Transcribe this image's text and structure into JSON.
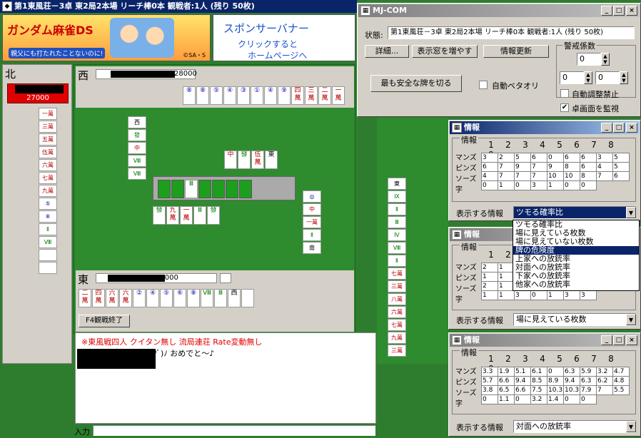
{
  "main": {
    "title": "第1東風荘－3卓 東2局2本場 リーチ棒0本 観戦者:1人 (残り 50枚)",
    "banner_left_line1": "ガンダム麻雀DS",
    "banner_left_line2": "親父にも打たれたことないのに!",
    "banner_copyright": "©SA・S",
    "banner_right_line1": "スポンサーバナー",
    "banner_right_line2": "クリックすると",
    "banner_right_line3": "ホームページへ"
  },
  "players": {
    "north": {
      "wind": "北",
      "score": "27000"
    },
    "west": {
      "wind": "西",
      "score": "28000"
    },
    "east": {
      "wind": "東",
      "score": "33000"
    }
  },
  "hands": {
    "west_hand": [
      {
        "t": "⑧",
        "c": "b"
      },
      {
        "t": "⑧",
        "c": "b"
      },
      {
        "t": "⑤",
        "c": "b"
      },
      {
        "t": "④",
        "c": "b"
      },
      {
        "t": "③",
        "c": "b"
      },
      {
        "t": "①",
        "c": "b"
      },
      {
        "t": "④",
        "c": "b"
      },
      {
        "t": "⑨",
        "c": "b"
      },
      {
        "t": "四萬",
        "c": "r"
      },
      {
        "t": "三萬",
        "c": "r"
      },
      {
        "t": "二萬",
        "c": "r"
      },
      {
        "t": "一萬",
        "c": "r"
      }
    ],
    "east_hand": [
      {
        "t": "二萬",
        "c": "r"
      },
      {
        "t": "四萬",
        "c": "r"
      },
      {
        "t": "六萬",
        "c": "r"
      },
      {
        "t": "六萬",
        "c": "r"
      },
      {
        "t": "②",
        "c": "b"
      },
      {
        "t": "④",
        "c": "b"
      },
      {
        "t": "⑤",
        "c": "b"
      },
      {
        "t": "⑥",
        "c": "b"
      },
      {
        "t": "⑧",
        "c": "b"
      },
      {
        "t": "Ⅷ",
        "c": "g"
      },
      {
        "t": "Ⅲ",
        "c": "g"
      },
      {
        "t": "西",
        "c": "k"
      },
      {
        "t": "",
        "c": "k"
      }
    ],
    "north_hand": [
      {
        "t": "一萬",
        "c": "r"
      },
      {
        "t": "三萬",
        "c": "r"
      },
      {
        "t": "五萬",
        "c": "r"
      },
      {
        "t": "伍萬",
        "c": "r"
      },
      {
        "t": "六萬",
        "c": "r"
      },
      {
        "t": "七萬",
        "c": "r"
      },
      {
        "t": "九萬",
        "c": "r"
      },
      {
        "t": "⑤",
        "c": "b"
      },
      {
        "t": "⑧",
        "c": "b"
      },
      {
        "t": "Ⅱ",
        "c": "g"
      },
      {
        "t": "Ⅷ",
        "c": "g"
      },
      {
        "t": "",
        "c": "k"
      },
      {
        "t": "",
        "c": "k"
      }
    ],
    "south_hand": [
      {
        "t": "東",
        "c": "k"
      },
      {
        "t": "Ⅸ",
        "c": "g"
      },
      {
        "t": "Ⅱ",
        "c": "g"
      },
      {
        "t": "Ⅲ",
        "c": "g"
      },
      {
        "t": "Ⅳ",
        "c": "g"
      },
      {
        "t": "Ⅷ",
        "c": "g"
      },
      {
        "t": "Ⅱ",
        "c": "g"
      },
      {
        "t": "七萬",
        "c": "r"
      },
      {
        "t": "三萬",
        "c": "r"
      },
      {
        "t": "八萬",
        "c": "r"
      },
      {
        "t": "六萬",
        "c": "r"
      },
      {
        "t": "七萬",
        "c": "r"
      },
      {
        "t": "九萬",
        "c": "r"
      },
      {
        "t": "三萬",
        "c": "r"
      }
    ],
    "west_discards": [
      {
        "t": "西",
        "c": "k"
      },
      {
        "t": "發",
        "c": "g"
      },
      {
        "t": "中",
        "c": "r"
      },
      {
        "t": "Ⅷ",
        "c": "g"
      },
      {
        "t": "Ⅷ",
        "c": "g"
      }
    ],
    "north_discards_top": [
      {
        "t": "中",
        "c": "r"
      },
      {
        "t": "發",
        "c": "g"
      },
      {
        "t": "伍萬",
        "c": "r"
      },
      {
        "t": "東",
        "c": "k"
      }
    ],
    "east_discards": [
      {
        "t": "發",
        "c": "g"
      },
      {
        "t": "九萬",
        "c": "r"
      },
      {
        "t": "一萬",
        "c": "r"
      },
      {
        "t": "Ⅲ",
        "c": "g"
      },
      {
        "t": "發",
        "c": "g"
      }
    ],
    "south_discards": [
      {
        "t": "◎",
        "c": "b"
      },
      {
        "t": "中",
        "c": "r"
      },
      {
        "t": "一萬",
        "c": "r"
      },
      {
        "t": "Ⅱ",
        "c": "g"
      },
      {
        "t": "南",
        "c": "k"
      }
    ]
  },
  "dora_row": [
    {
      "t": "",
      "c": "back"
    },
    {
      "t": "",
      "c": "back"
    },
    {
      "t": "Ⅲ",
      "c": "g"
    },
    {
      "t": "",
      "c": "back"
    },
    {
      "t": "",
      "c": "back"
    },
    {
      "t": "",
      "c": "back"
    },
    {
      "t": "",
      "c": "back"
    }
  ],
  "f4_label": "F4観戦終了",
  "chat": {
    "line1": "※東風戦四人 クイタン無し 流局連荘 Rate変動無し",
    "line2": "ﾌﾞ)ﾉ おめでと～♪",
    "input_label": "入力"
  },
  "mjcom": {
    "title": "MJ-COM",
    "state_label": "状態:",
    "state_value": "第1東風荘－3卓 東2局2本場 リーチ棒0本 観戦者:1人 (残り 50枚)",
    "btn_detail": "詳細...",
    "btn_more": "表示窓を増やす",
    "btn_update": "情報更新",
    "btn_safe": "最も安全な牌を切る",
    "auto_beta": "自動ベタオリ",
    "caution_label": "警戒係数",
    "caution_top": "0",
    "caution_left": "0",
    "caution_right": "0",
    "auto_adjust": "自動調整禁止",
    "watch_table": "卓画面を監視",
    "watch_checked": "✔"
  },
  "info_common": {
    "title": "情報",
    "section_label": "情報",
    "cols": [
      "1",
      "2",
      "3",
      "4",
      "5",
      "6",
      "7",
      "8",
      "9"
    ],
    "rows": [
      "マンズ",
      "ピンズ",
      "ソーズ",
      "字"
    ],
    "display_label": "表示する情報"
  },
  "info1": {
    "grid": [
      [
        "3",
        "2",
        "5",
        "6",
        "0",
        "6",
        "6",
        "3",
        "5"
      ],
      [
        "6",
        "7",
        "9",
        "7",
        "9",
        "8",
        "6",
        "4",
        "5"
      ],
      [
        "4",
        "7",
        "7",
        "7",
        "10",
        "10",
        "8",
        "7",
        "6"
      ],
      [
        "0",
        "1",
        "0",
        "3",
        "1",
        "0",
        "0",
        "",
        ""
      ]
    ],
    "select_value": "ツモる確率比",
    "dropdown": [
      "ツモる確率比",
      "場に見えている枚数",
      "場に見えていない枚数",
      "牌の危険度",
      "上家への放銃率",
      "対面への放銃率",
      "下家への放銃率",
      "他家への放銃率"
    ],
    "dropdown_selected_index": 3
  },
  "info2": {
    "cols": [
      "1",
      "2"
    ],
    "grid": [
      [
        "2",
        "1"
      ],
      [
        "1",
        "1"
      ],
      [
        "2",
        "1"
      ],
      [
        "1",
        "1",
        "3",
        "0",
        "1",
        "3",
        "3"
      ]
    ],
    "select_value": "場に見えている枚数"
  },
  "info3": {
    "grid": [
      [
        "3.3",
        "1.9",
        "5.1",
        "6.1",
        "0",
        "6.3",
        "5.9",
        "3.2",
        "4.7"
      ],
      [
        "5.7",
        "6.6",
        "9.4",
        "8.5",
        "8.9",
        "9.4",
        "6.3",
        "6.2",
        "4.8"
      ],
      [
        "3.8",
        "6.5",
        "6.6",
        "7.5",
        "10.3",
        "10.3",
        "7.9",
        "7",
        "5.5"
      ],
      [
        "0",
        "1.1",
        "0",
        "3.2",
        "1.4",
        "0",
        "0",
        "",
        ""
      ]
    ],
    "select_value": "対面への放銃率"
  }
}
